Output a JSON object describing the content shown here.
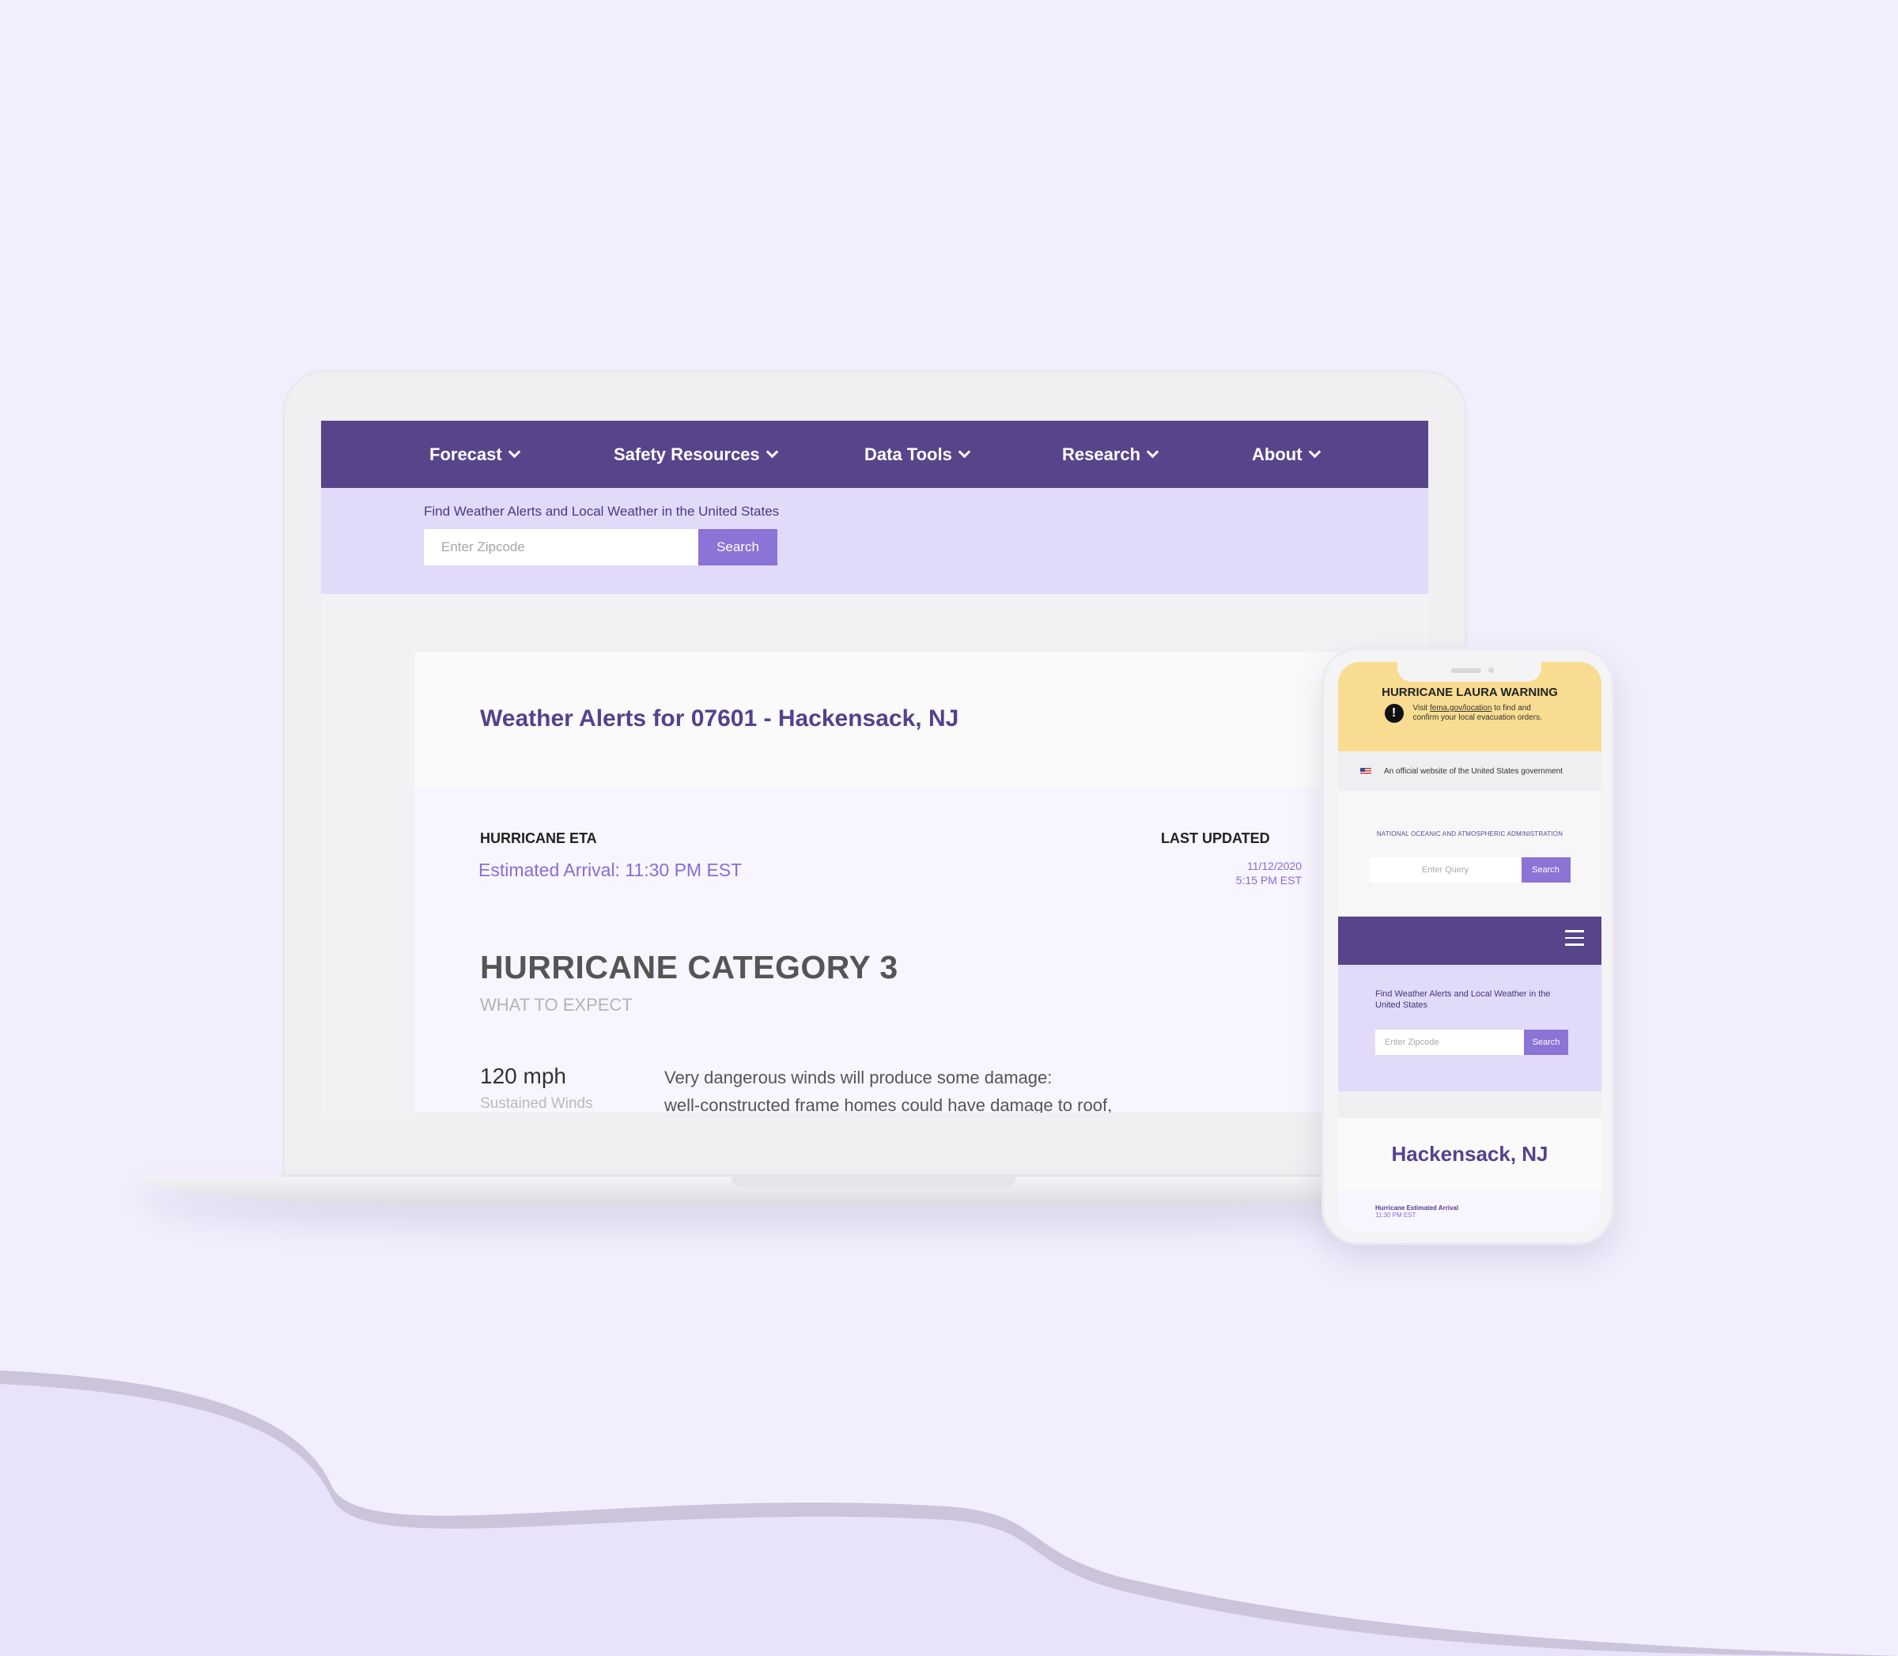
{
  "laptop": {
    "nav": [
      {
        "label": "Forecast"
      },
      {
        "label": "Safety Resources"
      },
      {
        "label": "Data Tools"
      },
      {
        "label": "Research"
      },
      {
        "label": "About"
      }
    ],
    "search": {
      "caption": "Find Weather Alerts and Local Weather in the United States",
      "placeholder": "Enter Zipcode",
      "button": "Search"
    },
    "alerts": {
      "title": "Weather Alerts for 07601 - Hackensack, NJ",
      "eta_label": "HURRICANE ETA",
      "eta_value": "Estimated Arrival:  11:30  PM EST",
      "updated_label": "LAST UPDATED",
      "updated_date": "11/12/2020",
      "updated_time": "5:15 PM EST",
      "category": "HURRICANE CATEGORY 3",
      "expect": "WHAT TO EXPECT",
      "wind_speed": "120 mph",
      "wind_label": "Sustained Winds",
      "wind_desc_1": "Very dangerous winds will produce some damage:",
      "wind_desc_2": "well-constructed frame homes could have damage to roof,"
    }
  },
  "phone": {
    "warning_title": "HURRICANE LAURA WARNING",
    "warning_prefix": "Visit ",
    "warning_link": "fema.gov/location",
    "warning_suffix": " to find and confirm your local evacuation orders.",
    "official": "An official website of the United States government",
    "agency": "NATIONAL OCEANIC AND ATMOSPHERIC ADMINISTRATION",
    "query_placeholder": "Enter Query",
    "query_button": "Search",
    "find_text": "Find Weather Alerts and Local Weather in the United States",
    "zip_placeholder": "Enter Zipcode",
    "zip_button": "Search",
    "city": "Hackensack, NJ",
    "eta_label": "Hurricane Estimated Arrival",
    "eta_value": "11:30  PM EST"
  },
  "colors": {
    "brand_purple": "#58448b",
    "accent_purple": "#8c73d6",
    "band_lavender": "#e1dbf9",
    "warning_yellow": "#f8dc91",
    "background": "#f2eefd"
  }
}
